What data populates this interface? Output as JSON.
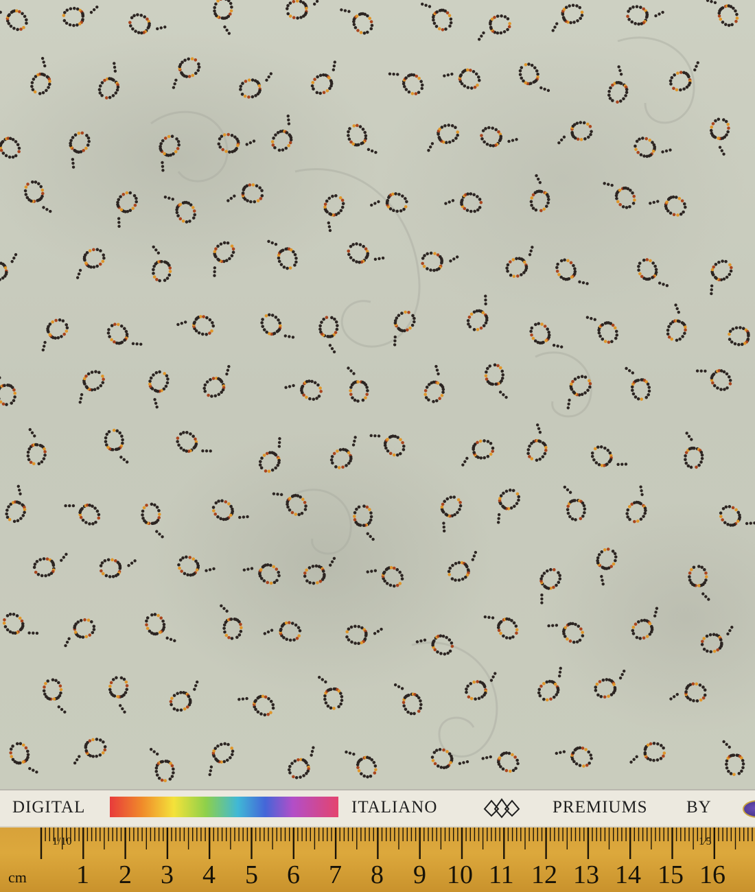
{
  "selvedge": {
    "word1": "DIGITAL",
    "word2": "ITALIANO",
    "word3": "PREMIUMS",
    "word4": "BY"
  },
  "ruler": {
    "unit_label": "cm",
    "tenth_label": "1/10",
    "fifth_label": "1⁄5",
    "numbers": [
      "1",
      "2",
      "3",
      "4",
      "5",
      "6",
      "7",
      "8",
      "9",
      "10",
      "11",
      "12",
      "13",
      "14",
      "15",
      "16"
    ]
  },
  "colors": {
    "fabric": "#c9ccbe",
    "dot_dark": "#2c2522",
    "dot_orange": "#e0962a",
    "dot_rust": "#a9451e",
    "ruler": "#d8a23a"
  }
}
